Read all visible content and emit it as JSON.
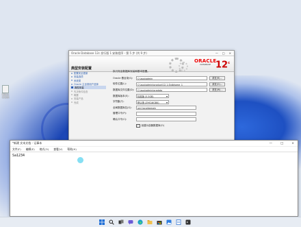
{
  "desktop": {
    "icon_label": "新建文本文档"
  },
  "installer": {
    "title": "Oracle Database 12c 发行版 1 安装程序 - 第 5 步 (共 9 步)",
    "title_controls": [
      "—",
      "□",
      "×"
    ],
    "header": "典型安装配置",
    "logo_text": "ORACLE",
    "logo_sub": "DATABASE",
    "logo_version": "12",
    "logo_version_sup": "c",
    "steps": [
      {
        "label": "配置安全更新",
        "state": "done"
      },
      {
        "label": "安装选项",
        "state": "done"
      },
      {
        "label": "系统类",
        "state": "done"
      },
      {
        "label": "Oracle 主目录用户选择",
        "state": "done"
      },
      {
        "label": "典型安装",
        "state": "active"
      },
      {
        "label": "先决条件检查",
        "state": "pending"
      },
      {
        "label": "概要",
        "state": "pending"
      },
      {
        "label": "安装产品",
        "state": "pending"
      },
      {
        "label": "完成",
        "state": "pending"
      }
    ],
    "intro": "执行完全数据库安装和基本配置。",
    "fields": [
      {
        "label": "Oracle 基目录(S):",
        "value": "C:\\app\\admin",
        "type": "input",
        "button": "浏览(R)..."
      },
      {
        "label": "软件位置(L):",
        "value": "C:\\app\\admin\\product\\12.1.0\\dbhome_1",
        "type": "input",
        "button": "浏览(O)..."
      },
      {
        "label": "数据库文件位置(D):",
        "value": "C:\\app\\admin\\oradata",
        "type": "input",
        "button": "浏览(W)..."
      },
      {
        "label": "数据库版本(E):",
        "value": "标准版 (5.5GB)",
        "type": "select"
      },
      {
        "label": "字符集(T):",
        "value": "默认值 (ZHS16GBK)",
        "type": "select"
      },
      {
        "label": "全局数据库名(G):",
        "value": "orcl.localdomain",
        "type": "input"
      },
      {
        "label": "管理口令(P):",
        "value": "",
        "type": "input"
      },
      {
        "label": "确认口令(C):",
        "value": "",
        "type": "input"
      }
    ],
    "checkbox_label": "创建为容器数据库(O)",
    "checkbox_checked": true
  },
  "notepad": {
    "title": "*新建 文本文档 - 记事本",
    "controls": [
      "—",
      "□",
      "×"
    ],
    "menu": [
      "文件(F)",
      "编辑(E)",
      "格式(O)",
      "查看(V)",
      "帮助(H)"
    ],
    "content": "Sa1234"
  },
  "taskbar": {
    "icons": [
      "windows-start",
      "search",
      "task-view",
      "chat",
      "edge",
      "file-explorer",
      "store",
      "photos",
      "notepad",
      "terminal"
    ]
  }
}
